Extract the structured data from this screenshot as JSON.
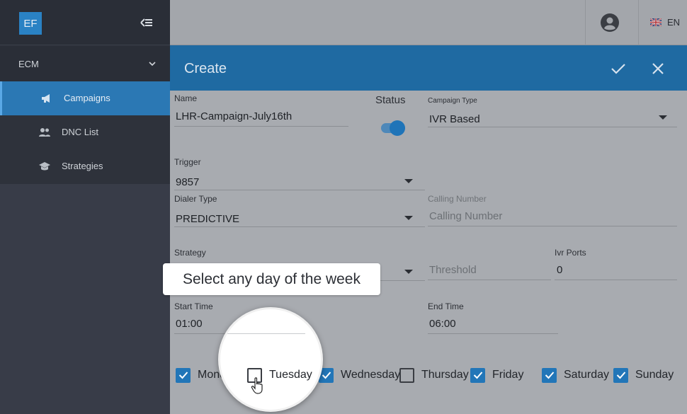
{
  "sidebar": {
    "logo": "EF",
    "section": "ECM",
    "items": [
      {
        "label": "Campaigns",
        "icon": "megaphone-icon",
        "active": true
      },
      {
        "label": "DNC List",
        "icon": "users-icon",
        "active": false
      },
      {
        "label": "Strategies",
        "icon": "graduation-cap-icon",
        "active": false
      }
    ]
  },
  "header": {
    "language": "EN"
  },
  "dialog": {
    "title": "Create",
    "name": {
      "label": "Name",
      "value": "LHR-Campaign-July16th"
    },
    "status": {
      "label": "Status",
      "enabled": true
    },
    "campaign_type": {
      "label": "Campaign Type",
      "value": "IVR Based"
    },
    "trigger": {
      "label": "Trigger",
      "value": "9857"
    },
    "dialer_type": {
      "label": "Dialer Type",
      "value": "PREDICTIVE"
    },
    "calling_number": {
      "label": "Calling Number",
      "placeholder": "Calling Number"
    },
    "strategy": {
      "label": "Strategy"
    },
    "threshold": {
      "placeholder": "Threshold"
    },
    "ivr_ports": {
      "label": "Ivr Ports",
      "value": "0"
    },
    "start_time": {
      "label": "Start Time",
      "value": "01:00"
    },
    "end_time": {
      "label": "End Time",
      "value": "06:00"
    },
    "days": [
      {
        "label": "Monday",
        "checked": true
      },
      {
        "label": "Tuesday",
        "checked": false
      },
      {
        "label": "Wednesday",
        "checked": true
      },
      {
        "label": "Thursday",
        "checked": false
      },
      {
        "label": "Friday",
        "checked": true
      },
      {
        "label": "Saturday",
        "checked": true
      },
      {
        "label": "Sunday",
        "checked": true
      }
    ]
  },
  "tooltip": "Select any day of the week",
  "colors": {
    "accent": "#1f6aa2",
    "sidebar": "#2e323b",
    "checkbox": "#2276b8"
  }
}
